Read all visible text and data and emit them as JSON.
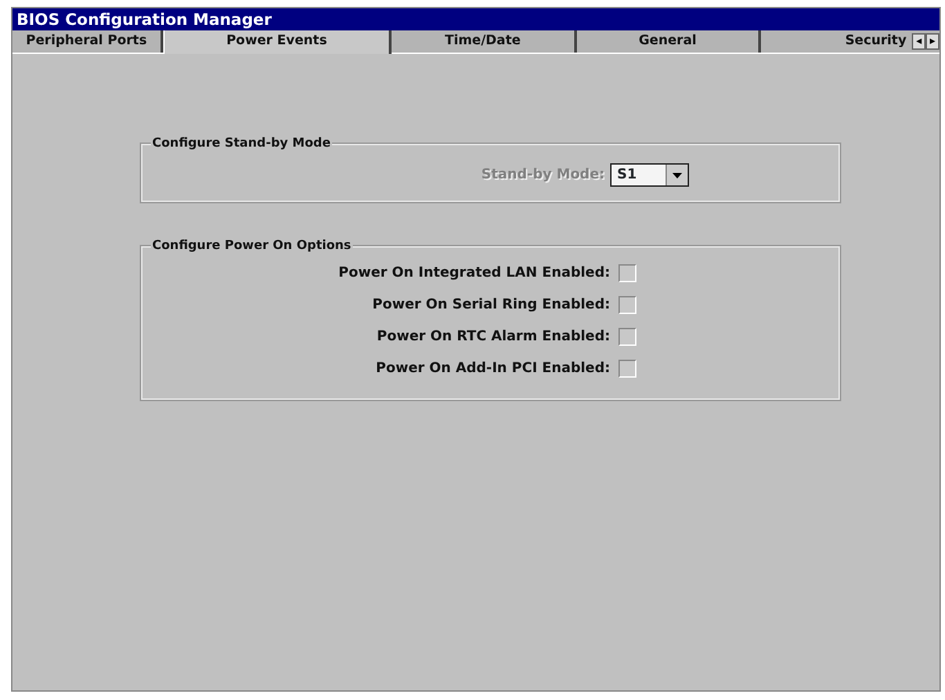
{
  "window": {
    "title": "BIOS Configuration Manager"
  },
  "tabs": [
    {
      "label": "Peripheral Ports",
      "selected": false
    },
    {
      "label": "Power Events",
      "selected": true
    },
    {
      "label": "Time/Date",
      "selected": false
    },
    {
      "label": "General",
      "selected": false
    },
    {
      "label": "Security",
      "selected": false
    }
  ],
  "tab_scroll": [
    "◂",
    "▸"
  ],
  "groups": [
    {
      "title": "Configure Stand-by Mode",
      "items": [
        {
          "kind": "select",
          "label": "Stand-by Mode:",
          "value": "S1",
          "disabled": true
        }
      ]
    },
    {
      "title": "Configure Power On Options",
      "items": [
        {
          "kind": "checkbox",
          "label": "Power On Integrated LAN Enabled:",
          "checked": false
        },
        {
          "kind": "checkbox",
          "label": "Power On Serial Ring Enabled:",
          "checked": false
        },
        {
          "kind": "checkbox",
          "label": "Power On RTC Alarm Enabled:",
          "checked": false
        },
        {
          "kind": "checkbox",
          "label": "Power On Add-In PCI Enabled:",
          "checked": false
        }
      ]
    }
  ]
}
